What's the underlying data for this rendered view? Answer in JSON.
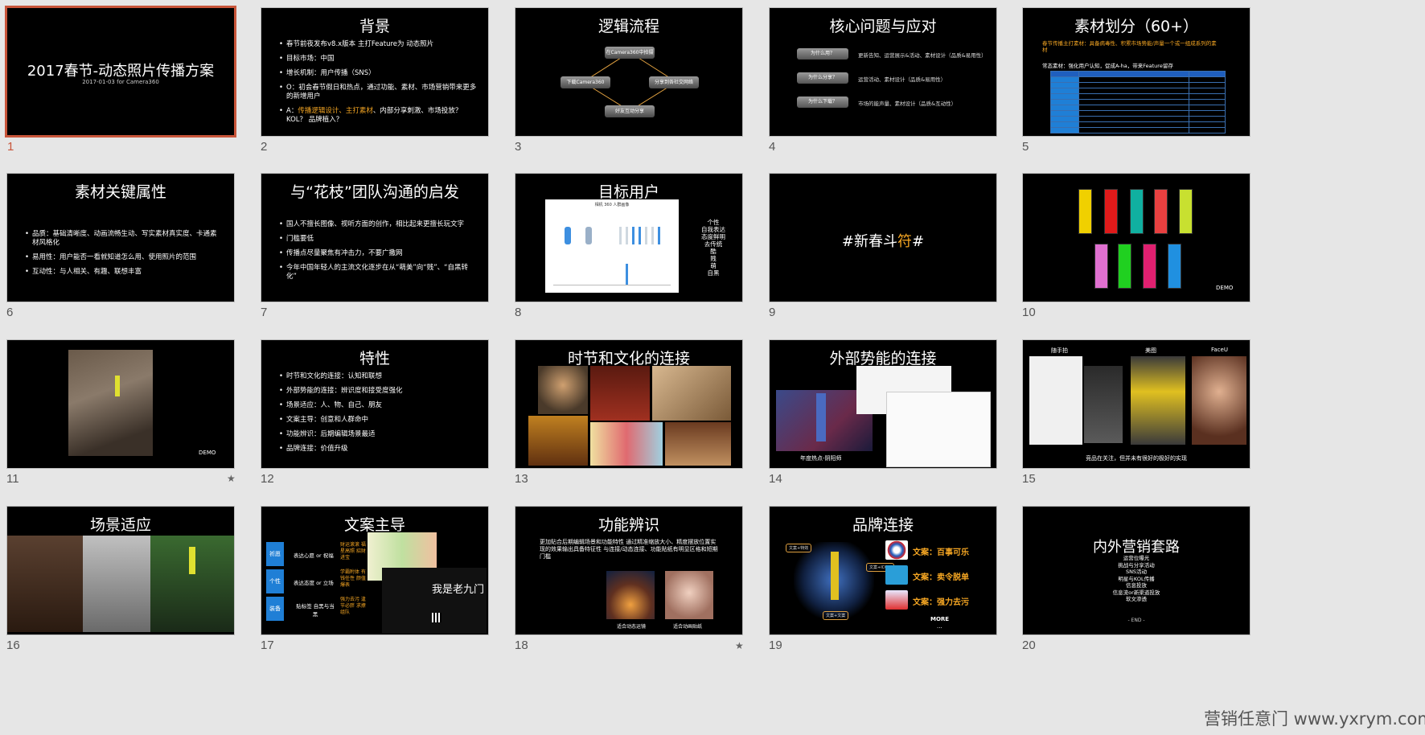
{
  "slides": [
    {
      "num": "1",
      "title": "2017春节-动态照片传播方案",
      "subtitle": "2017-01-03 for Camera360"
    },
    {
      "num": "2",
      "title": "背景",
      "bullets": [
        "春节前夜发布v8.x版本 主打Feature为 动态照片",
        "目标市场：中国",
        "增长机制：用户传播（SNS）",
        "O：初会春节假日和热点，通过功能、素材、市场营销带来更多的新增用户"
      ],
      "last_prefix": "A：",
      "last_hl": "传播逻辑设计、主打素材",
      "last_suffix": "、内部分享刺激、市场投放？ KOL？ 品牌植入？"
    },
    {
      "num": "3",
      "title": "逻辑流程",
      "nodes": [
        "在Camera360中拍摄",
        "下载Camera360",
        "分享到各社交网络",
        "好友互动分享"
      ]
    },
    {
      "num": "4",
      "title": "核心问题与应对",
      "rows": [
        {
          "q": "为什么用？",
          "a": "更新告知、运营展示&活动、素材设计（品质&易用性）"
        },
        {
          "q": "为什么分享？",
          "a": "运营活动、素材设计（品质&易用性）"
        },
        {
          "q": "为什么下载？",
          "a": "市场的能声量、素材设计（品质&互动性）"
        }
      ]
    },
    {
      "num": "5",
      "title": "素材划分（60+）",
      "b1": "春节传播主打素材：具备病毒性、积累市场势能/声量一个或一组成系列的素材",
      "b2": "常态素材：强化用户认知，促成A-ha，带来Feature留存"
    },
    {
      "num": "6",
      "title": "素材关键属性",
      "bullets": [
        "品质：基础清晰度、动画流畅生动、写实素材真实度、卡通素材风格化",
        "易用性：用户能否一看就知道怎么用、使用照片的范围",
        "互动性：与人相关、有趣、联想丰富"
      ]
    },
    {
      "num": "7",
      "title": "与“花枝”团队沟通的启发",
      "bullets": [
        "国人不擅长图像、视听方面的创作，相比起来更擅长玩文字",
        "门槛要低",
        "传播点尽量聚焦有冲击力，不要广撒网",
        "今年中国年轻人的主流文化逐步在从“萌美”向“贱”、“自黑转化”"
      ]
    },
    {
      "num": "8",
      "title": "目标用户",
      "chart_title": "相机 360 人群画像",
      "tags": [
        "个性",
        "自我表达",
        "态度鲜明",
        "去传统",
        "酷",
        "贱",
        "萌",
        "自黑"
      ]
    },
    {
      "num": "9",
      "prefix": "#新春斗",
      "accent": "符",
      "suffix": "#"
    },
    {
      "num": "10",
      "demo": "DEMO"
    },
    {
      "num": "11",
      "demo": "DEMO",
      "star": "★"
    },
    {
      "num": "12",
      "title": "特性",
      "bullets": [
        "时节和文化的连接：认知和联想",
        "外部势能的连接：辨识度和接受度强化",
        "场景适应：人、物、自己、朋友",
        "文案主导：创意和人群命中",
        "功能辨识：后期编辑场景最适",
        "品牌连接：价值升级"
      ]
    },
    {
      "num": "13",
      "title": "时节和文化的连接"
    },
    {
      "num": "14",
      "title": "外部势能的连接",
      "caption": "年度热点-阴阳师"
    },
    {
      "num": "15",
      "labels": [
        "随手拍",
        "美图",
        "FaceU"
      ],
      "caption": "竞品在关注，但并未有很好的极好的实现"
    },
    {
      "num": "16",
      "title": "场景适应"
    },
    {
      "num": "17",
      "title": "文案主导",
      "rows": [
        {
          "label": "祈愿",
          "mid": "表达心愿 or 祝福",
          "right": "财运滚滚 福星高照 招财进宝"
        },
        {
          "label": "个性",
          "mid": "表达态度 or 立场",
          "right": "学霸附体 有钱任性 颜值爆表"
        },
        {
          "label": "装备",
          "mid": "贴标签 自黑与当黑",
          "right": "强力去污 逢节必胖 求撩组队"
        }
      ],
      "handwriting": "我是老九门"
    },
    {
      "num": "18",
      "title": "功能辨识",
      "bullet": "更加贴合后期编辑场景和功能特性 通过精准缩放大小、精度摆放位置实现的效果输出具备特征性 与连接/动态连接、功能贴纸有明显区格和短期门槛",
      "cap1": "适合动态运镜",
      "cap2": "适合动画贴纸",
      "star": "★"
    },
    {
      "num": "19",
      "title": "品牌连接",
      "brands": [
        {
          "text": "文案：百事可乐",
          "color": "#1f5fbf"
        },
        {
          "text": "文案：卖令脱单",
          "color": "#2a9ed8"
        },
        {
          "text": "文案：强力去污",
          "color": "#e8e8ff"
        }
      ],
      "more": "MORE",
      "dots": "...",
      "callouts": [
        "文案+特效",
        "文案+ICON",
        "文案+文案"
      ]
    },
    {
      "num": "20",
      "title": "内外营销套路",
      "items": [
        "运营位曝光",
        "挑战与分享活动",
        "SNS活动",
        "明星与KOL传播",
        "信息投放",
        "信息流or新渠道投放",
        "软文渗透"
      ],
      "end": "- END -"
    }
  ],
  "watermark": "营销任意门 www.yxrym.com"
}
